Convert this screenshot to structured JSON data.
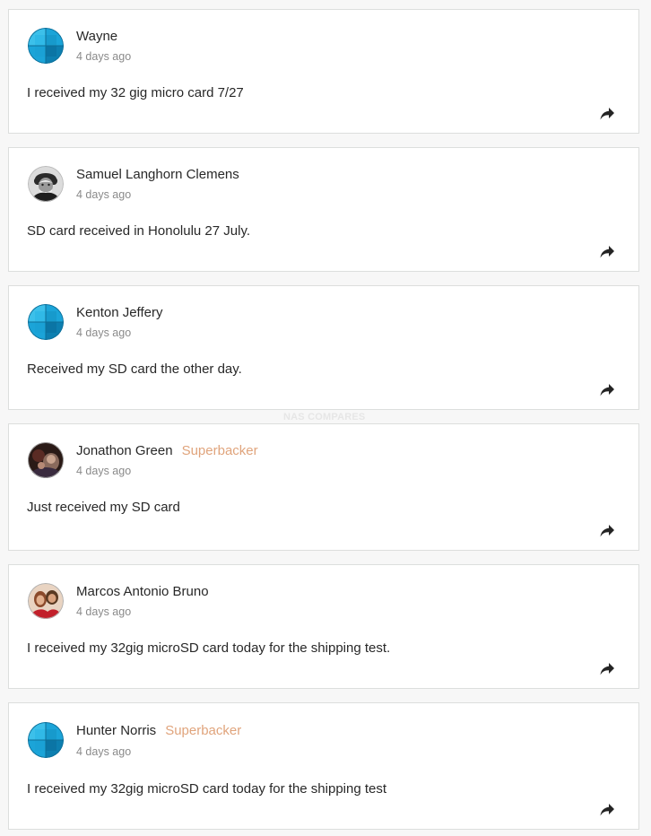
{
  "watermark": "NAS COMPARES",
  "comments": [
    {
      "name": "Wayne",
      "badge": "",
      "time": "4 days ago",
      "text": "I received my 32 gig micro card 7/27",
      "avatar": "default-globe-avatar"
    },
    {
      "name": "Samuel Langhorn Clemens",
      "badge": "",
      "time": "4 days ago",
      "text": "SD card received in Honolulu 27 July.",
      "avatar": "photo-avatar-bw-portrait"
    },
    {
      "name": "Kenton Jeffery",
      "badge": "",
      "time": "4 days ago",
      "text": "Received my SD card the other day.",
      "avatar": "default-globe-avatar"
    },
    {
      "name": "Jonathon Green",
      "badge": "Superbacker",
      "time": "4 days ago",
      "text": "Just received my SD card",
      "avatar": "photo-avatar-dark"
    },
    {
      "name": "Marcos Antonio Bruno",
      "badge": "",
      "time": "4 days ago",
      "text": "I received my 32gig microSD card today for the shipping test.",
      "avatar": "photo-avatar-warm"
    },
    {
      "name": "Hunter Norris",
      "badge": "Superbacker",
      "time": "4 days ago",
      "text": "I received my 32gig microSD card today for the shipping test",
      "avatar": "default-globe-avatar"
    }
  ],
  "colors": {
    "badge": "#e0a47c",
    "timestamp": "#8a8a8a",
    "text": "#282828",
    "card_border": "#dcdedd",
    "avatar_teal": "#1ba4d8"
  }
}
